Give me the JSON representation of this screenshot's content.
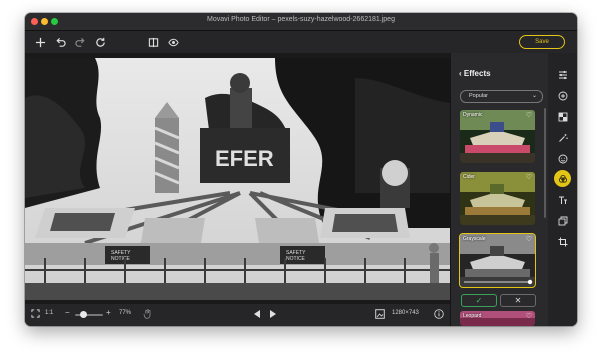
{
  "window": {
    "title": "Movavi Photo Editor – pexels-suzy-hazelwood-2662181.jpeg"
  },
  "toolbar": {
    "icons": [
      "plus-icon",
      "undo-icon",
      "redo-icon",
      "reset-icon",
      "compare-icon",
      "preview-eye-icon"
    ],
    "save_label": "Save"
  },
  "bottombar": {
    "ratio_label": "1:1",
    "zoom_minus": "−",
    "zoom_plus": "+",
    "zoom_value": "77%",
    "zoom_fraction": 0.3,
    "dimensions": "1280×743"
  },
  "effects": {
    "title": "Effects",
    "filter_selected": "Popular",
    "items": [
      {
        "name": "Dynamic",
        "selected": false
      },
      {
        "name": "Cider",
        "selected": false
      },
      {
        "name": "Grayscale",
        "selected": true,
        "intensity": 1.0
      },
      {
        "name": "Leopard",
        "selected": false
      }
    ],
    "apply_label": "✓",
    "cancel_label": "✕"
  },
  "rail": {
    "icons": [
      "adjust-sliders-icon",
      "retouch-icon",
      "background-icon",
      "magic-wand-icon",
      "face-icon",
      "effects-icon",
      "text-icon",
      "resize-icon",
      "crop-icon"
    ],
    "active": "effects-icon"
  },
  "colors": {
    "accent": "#e3c516",
    "apply_green": "#3bbf64",
    "window_bg": "#1d1d1f",
    "panel_bg": "#2a2a2c"
  }
}
